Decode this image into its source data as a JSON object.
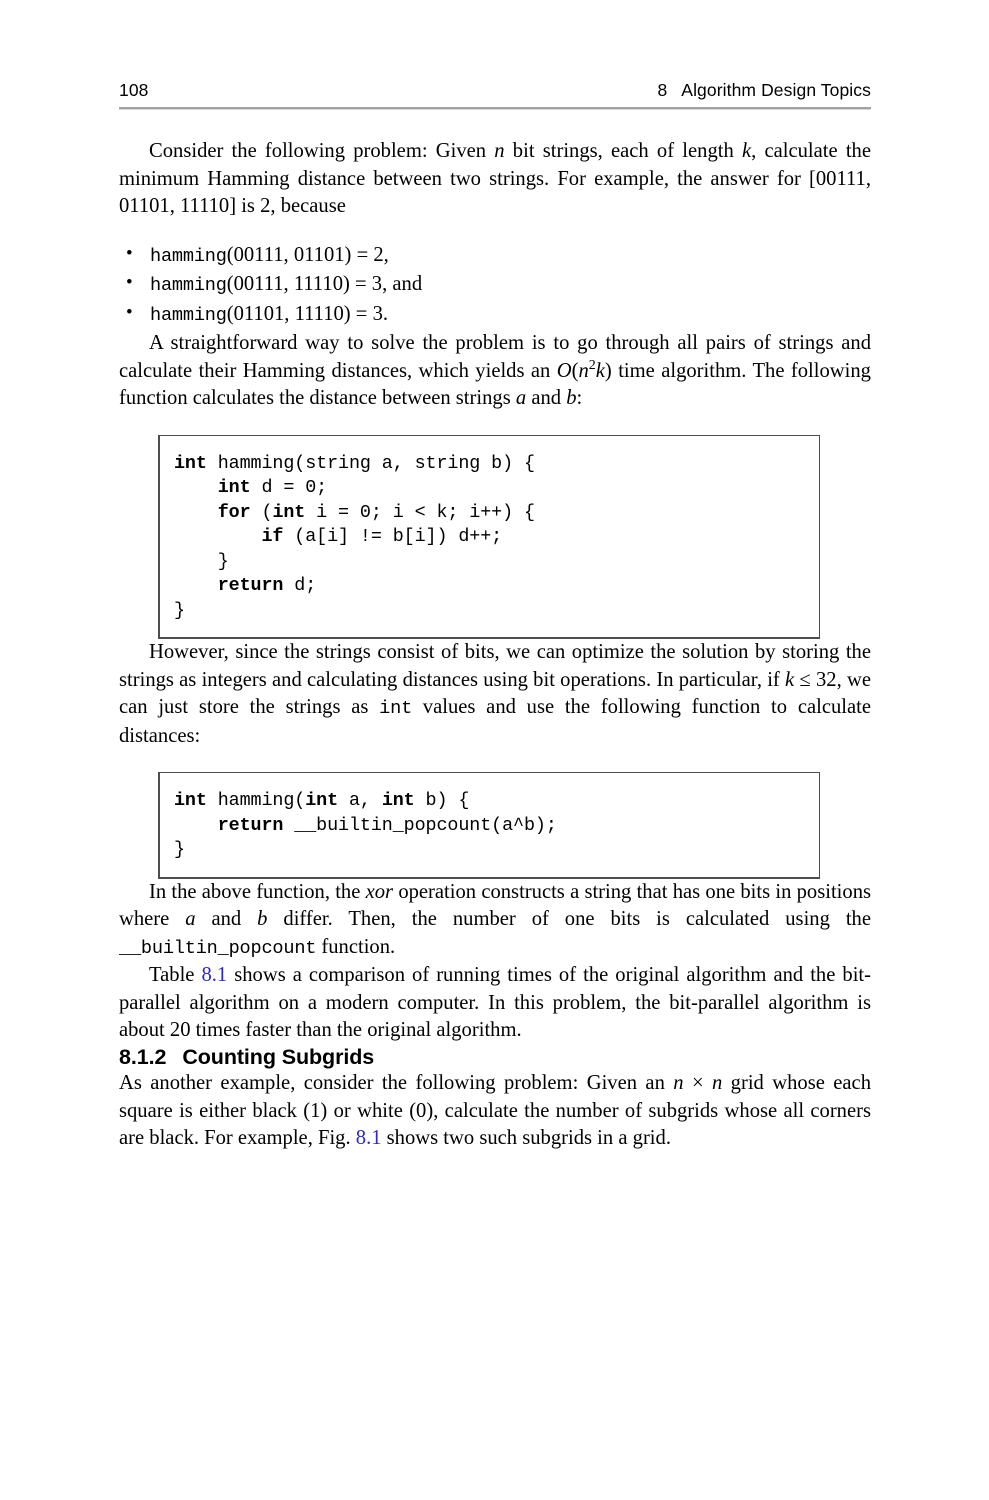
{
  "header": {
    "page_number": "108",
    "chapter_number": "8",
    "chapter_title": "Algorithm Design Topics"
  },
  "paragraphs": {
    "p1": {
      "seg1": "Consider the following problem: Given ",
      "var_n": "n",
      "seg2": " bit strings, each of length ",
      "var_k": "k",
      "seg3": ", calculate the minimum Hamming distance between two strings. For example, the answer for [00111, 01101, 11110] is 2, because"
    },
    "p2": {
      "seg1": "A straightforward way to solve the problem is to go through all pairs of strings and calculate their Hamming distances, which yields an ",
      "bigO": "O",
      "paren_open": "(",
      "var_n": "n",
      "exp": "2",
      "var_k": "k",
      "paren_close": ")",
      "seg2": " time algorithm. The following function calculates the distance between strings ",
      "var_a": "a",
      "seg3": " and ",
      "var_b": "b",
      "seg4": ":"
    },
    "p3": {
      "seg1": "However, since the strings consist of bits, we can optimize the solution by storing the strings as integers and calculating distances using bit operations. In particular, if ",
      "var_k": "k",
      "seg2": " ≤ 32, we can just store the strings as ",
      "code_int": "int",
      "seg3": " values and use the following function to calculate distances:"
    },
    "p4": {
      "seg1": "In the above function, the ",
      "xor": "xor",
      "seg2": " operation constructs a string that has one bits in positions where ",
      "var_a": "a",
      "seg3": " and ",
      "var_b": "b",
      "seg4": " differ. Then, the number of one bits is calculated using the ",
      "code_popcount": "__builtin_popcount",
      "seg5": " function."
    },
    "p5": {
      "seg1": "Table ",
      "ref": "8.1",
      "seg2": " shows a comparison of running times of the original algorithm and the bit-parallel algorithm on a modern computer. In this problem, the bit-parallel algorithm is about 20 times faster than the original algorithm."
    },
    "p6": {
      "seg1": "As another example, consider the following problem: Given an ",
      "var_n1": "n",
      "seg2": " × ",
      "var_n2": "n",
      "seg3": " grid whose each square is either black (1) or white (0), calculate the number of subgrids whose all corners are black. For example, Fig. ",
      "ref": "8.1",
      "seg4": " shows two such subgrids in a grid."
    }
  },
  "bullets": [
    {
      "fn": "hamming",
      "args": "(00111, 01101)",
      "result": " = 2,"
    },
    {
      "fn": "hamming",
      "args": "(00111, 11110)",
      "result": " = 3, and"
    },
    {
      "fn": "hamming",
      "args": "(01101, 11110)",
      "result": " = 3."
    }
  ],
  "code_blocks": {
    "block1": [
      {
        "kw": "int",
        "rest": " hamming(string a, string b) {"
      },
      {
        "indent": "    ",
        "kw": "int",
        "rest": " d = 0;"
      },
      {
        "indent": "    ",
        "kw": "for",
        "rest": " (",
        "kw2": "int",
        "rest2": " i = 0; i < k; i++) {"
      },
      {
        "indent": "        ",
        "kw": "if",
        "rest": " (a[i] != b[i]) d++;"
      },
      {
        "indent": "    ",
        "rest": "}"
      },
      {
        "indent": "    ",
        "kw": "return",
        "rest": " d;"
      },
      {
        "rest": "}"
      }
    ],
    "block2": [
      {
        "kw": "int",
        "rest": " hamming(",
        "kw2": "int",
        "rest2": " a, ",
        "kw3": "int",
        "rest3": " b) {"
      },
      {
        "indent": "    ",
        "kw": "return",
        "rest": " __builtin_popcount(a^b);"
      },
      {
        "rest": "}"
      }
    ]
  },
  "section": {
    "number": "8.1.2",
    "title": "Counting Subgrids"
  },
  "colors": {
    "reference_link": "#2b2bbd",
    "rule": "#a2a2a2",
    "code_border": "#4d4d4d",
    "text": "#000000",
    "background": "#ffffff"
  }
}
